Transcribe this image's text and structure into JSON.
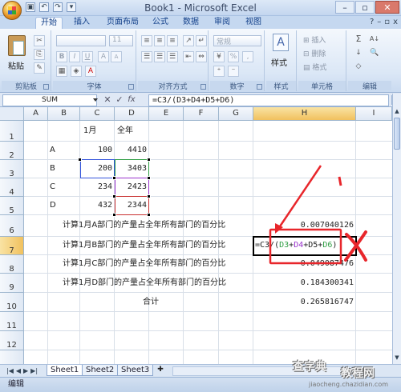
{
  "window": {
    "title": "Book1 - Microsoft Excel"
  },
  "qat": {
    "save_glyph": "▣",
    "undo_glyph": "↶",
    "redo_glyph": "↷",
    "more_glyph": "▾"
  },
  "window_controls": {
    "minimize": "–",
    "maximize": "▫",
    "close": "✕"
  },
  "tabs": [
    "开始",
    "插入",
    "页面布局",
    "公式",
    "数据",
    "审阅",
    "视图"
  ],
  "tabs_right": {
    "help": "?",
    "minimize": "–",
    "restore": "▫",
    "close": "x"
  },
  "ribbon": {
    "groups": [
      "剪贴板",
      "字体",
      "对齐方式",
      "数字",
      "样式",
      "单元格",
      "编辑"
    ],
    "clipboard": {
      "paste_label": "粘贴"
    },
    "font": {
      "font_name": "",
      "font_size": "11",
      "bold": "B",
      "italic": "I",
      "underline": "U",
      "grow": "A",
      "shrink": "A",
      "font_color": "A"
    },
    "number": {
      "format": "常规",
      "percent": "%",
      "comma": ","
    },
    "styles": {
      "label": "样式",
      "icon_glyph": "A"
    },
    "cells": {
      "insert": "插入",
      "delete": "删除",
      "format": "格式"
    },
    "editing": {
      "sum": "Σ",
      "sort": "A↓",
      "fill": "↓",
      "clear": "◇"
    }
  },
  "formula_bar": {
    "name_box": "SUM",
    "cancel": "✕",
    "enter": "✓",
    "fx": "fx",
    "formula": "=C3/(D3+D4+D5+D6)"
  },
  "columns": [
    "A",
    "B",
    "C",
    "D",
    "E",
    "F",
    "G",
    "H",
    "I"
  ],
  "selected_column": "H",
  "rows": [
    "1",
    "2",
    "3",
    "4",
    "5",
    "6",
    "7",
    "8",
    "9",
    "10",
    "11",
    "12"
  ],
  "selected_row": "7",
  "sheet": {
    "c1": "1月",
    "d1": "全年",
    "b2": "A",
    "c2": "100",
    "d2": "4410",
    "b3": "B",
    "c3": "200",
    "d3": "3403",
    "b4": "C",
    "c4": "234",
    "d4": "2423",
    "b5": "D",
    "c5": "432",
    "d5": "2344",
    "b6": "计算1月A部门的产量占全年所有部门的百分比",
    "h6": "0.007040126",
    "b7": "计算1月B部门的产量占全年所有部门的百分比",
    "b8": "计算1月C部门的产量占全年所有部门的百分比",
    "h8": "0.049087476",
    "b9": "计算1月D部门的产量占全年所有部门的百分比",
    "h9": "0.184300341",
    "d10": "合计",
    "h10": "0.265816747"
  },
  "active_cell_formula": {
    "p1": "=C3/(",
    "p2": "D3",
    "p3": "+",
    "p4": "D4",
    "p5": "+D5+",
    "p6": "D6",
    "p7": ")"
  },
  "colors": {
    "ref_blue": "#3355dd",
    "ref_green": "#2f9e44",
    "ref_purple": "#9933cc",
    "ref_red": "#c83030",
    "annotation_red": "#e8262b"
  },
  "sheets": [
    "Sheet1",
    "Sheet2",
    "Sheet3"
  ],
  "status": {
    "mode": "编辑"
  },
  "watermark": {
    "line1": "查字典",
    "line2": "教程网",
    "url": "jiaocheng.chazidian.com"
  }
}
